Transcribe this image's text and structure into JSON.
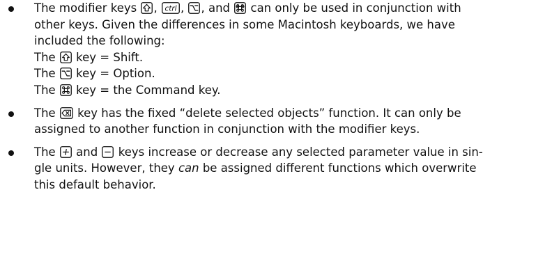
{
  "bullets": [
    {
      "line1": {
        "pre": "The modifier keys ",
        "sep1": ", ",
        "sep2": ", ",
        "sep3": ", and ",
        "post": " can only be used in conjunction with"
      },
      "line2": "other keys. Given the differences in some Macintosh keyboards, we have",
      "line3": "included the following:",
      "mappings": [
        {
          "pre": "The ",
          "post": " key = Shift."
        },
        {
          "pre": "The ",
          "post": " key = Option."
        },
        {
          "pre": "The ",
          "post": " key = the Command key."
        }
      ]
    },
    {
      "line1": {
        "pre": "The ",
        "post": " key has the fixed “delete selected objects” function. It can only be"
      },
      "line2": "assigned to another function in conjunction with the modifier keys."
    },
    {
      "line1": {
        "pre": "The ",
        "mid": " and ",
        "post": " keys increase or decrease any selected parameter value in sin-"
      },
      "line2": {
        "pre": "gle units. However, they ",
        "em": "can",
        "post": " be assigned different functions which overwrite"
      },
      "line3": "this default behavior."
    }
  ],
  "keys": {
    "ctrl": "ctrl"
  },
  "icons": {
    "shift": "shift-key-icon",
    "ctrl": "ctrl-key-icon",
    "option": "option-key-icon",
    "command": "command-key-icon",
    "delete": "delete-key-icon",
    "plus": "plus-key-icon",
    "minus": "minus-key-icon"
  }
}
